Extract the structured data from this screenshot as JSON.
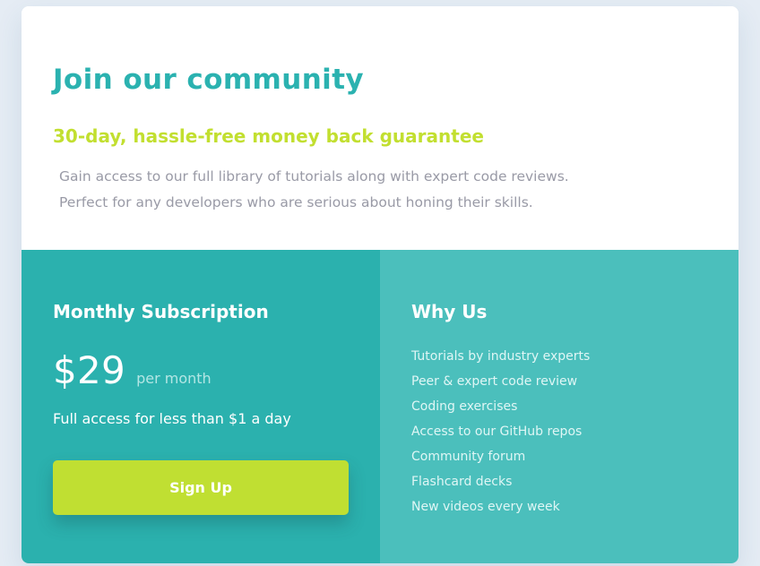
{
  "page": {
    "title": "Join our community",
    "guarantee": "30-day, hassle-free money back guarantee",
    "description": [
      "Gain access to our full library of tutorials along with expert code reviews.",
      "Perfect for any developers who are serious about honing their skills."
    ]
  },
  "subscription": {
    "title": "Monthly Subscription",
    "price": "$29",
    "period": "per month",
    "offer": "Full access for less than $1 a day",
    "button_label": "Sign Up"
  },
  "why_us": {
    "title": "Why Us",
    "items": [
      "Tutorials by industry experts",
      "Peer & expert code review",
      "Coding exercises",
      "Access to our GitHub repos",
      "Community forum",
      "Flashcard decks",
      "New videos every week"
    ]
  },
  "colors": {
    "background": "#e5ecf4",
    "card": "#ffffff",
    "teal_primary": "#2bb1ae",
    "teal_secondary": "#4bbfbc",
    "lime_accent": "#c0df32",
    "muted_text": "#999aa6"
  }
}
